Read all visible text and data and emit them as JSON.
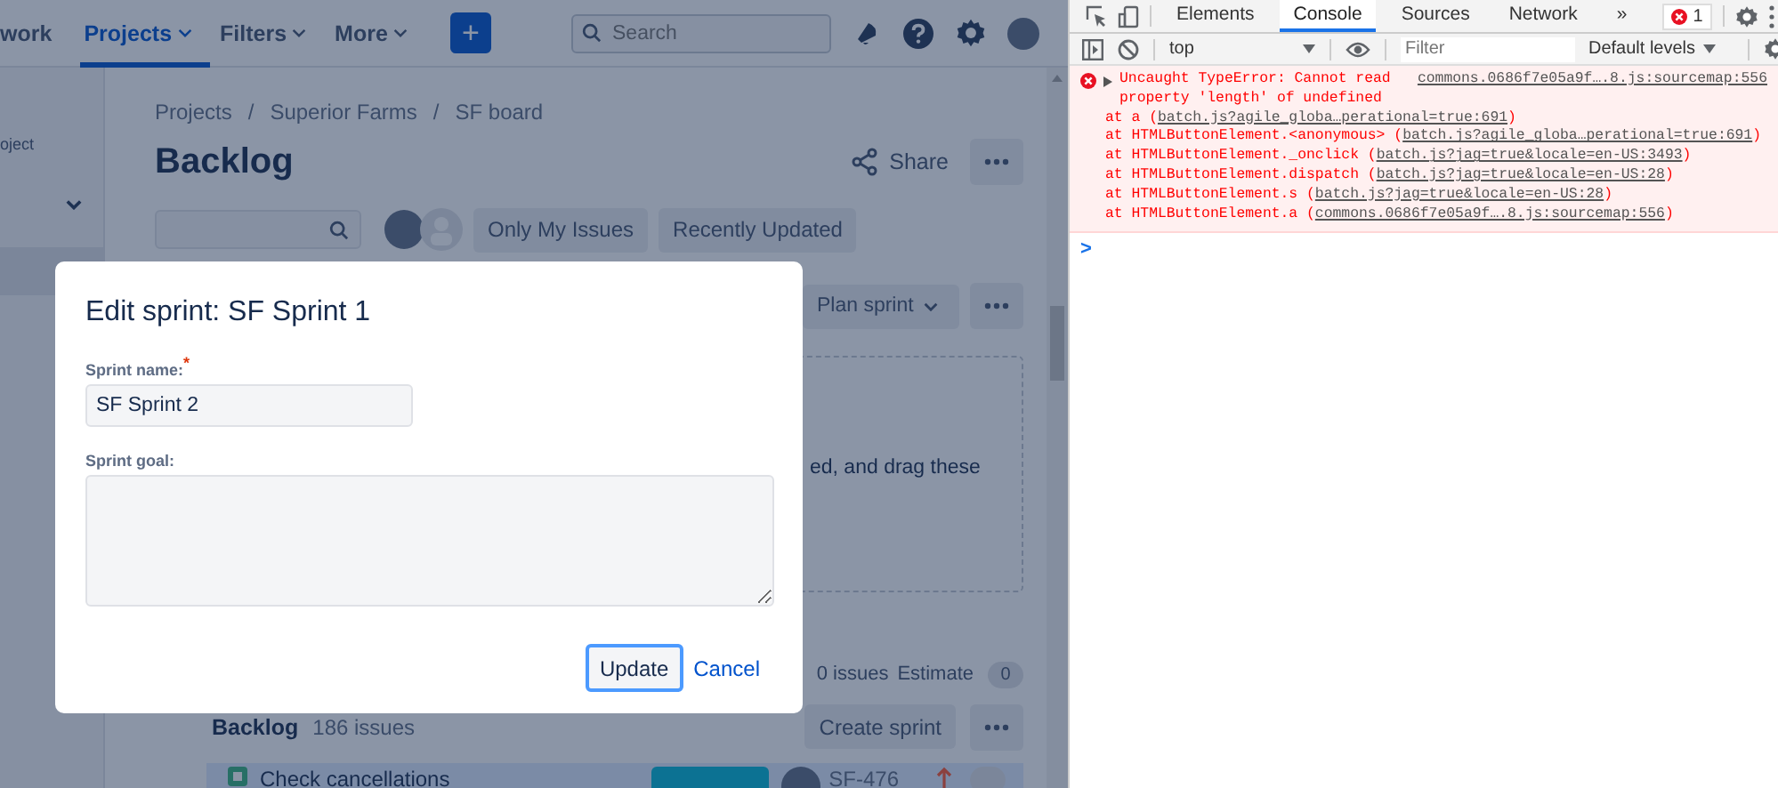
{
  "nav": {
    "items": [
      {
        "label": "work",
        "selected": false,
        "has_menu": false
      },
      {
        "label": "Projects",
        "selected": true,
        "has_menu": true
      },
      {
        "label": "Filters",
        "selected": false,
        "has_menu": true
      },
      {
        "label": "More",
        "selected": false,
        "has_menu": true
      }
    ],
    "create_label": "+",
    "search_placeholder": "Search"
  },
  "sidebar": {
    "items": [
      {
        "label": "oject"
      }
    ]
  },
  "breadcrumbs": [
    "Projects",
    "Superior Farms",
    "SF board"
  ],
  "breadcrumb_separator": "/",
  "title": "Backlog",
  "share_label": "Share",
  "quick_filters": [
    "Only My Issues",
    "Recently Updated"
  ],
  "sprint": {
    "plan_label": "Plan sprint",
    "empty_text": "ed, and drag these",
    "issue_count": "0 issues",
    "estimate_label": "Estimate",
    "estimate": "0"
  },
  "backlog": {
    "title": "Backlog",
    "count": "186 issues",
    "create_label": "Create sprint",
    "issues": [
      {
        "summary": "Check cancellations",
        "key": "SF-476"
      }
    ]
  },
  "modal": {
    "title": "Edit sprint: SF Sprint 1",
    "fields": [
      {
        "kind": "text",
        "label": "Sprint name:",
        "required_mark": "*",
        "value": "SF Sprint 2"
      },
      {
        "kind": "textarea",
        "label": "Sprint goal:"
      }
    ],
    "primary_label": "Update",
    "cancel_label": "Cancel"
  },
  "devtools": {
    "tabs": [
      {
        "label": "Elements",
        "selected": false
      },
      {
        "label": "Console",
        "selected": true
      },
      {
        "label": "Sources",
        "selected": false
      },
      {
        "label": "Network",
        "selected": false
      }
    ],
    "overflow": "»",
    "error_count": "1",
    "context": "top",
    "filter_placeholder": "Filter",
    "levels": "Default levels",
    "messages": [
      {
        "kind": "error",
        "text": "Uncaught TypeError: Cannot read property 'length' of undefined",
        "source": "commons.0686f7e05a9f….8.js:sourcemap:556",
        "stack": [
          {
            "prefix": "at a (",
            "link": "batch.js?agile_globa…perational=true:691",
            "suffix": ")"
          },
          {
            "prefix": "at HTMLButtonElement.<anonymous> (",
            "link": "batch.js?agile_globa…perational=true:691",
            "suffix": ")"
          },
          {
            "prefix": "at HTMLButtonElement._onclick (",
            "link": "batch.js?jag=true&locale=en-US:3493",
            "suffix": ")"
          },
          {
            "prefix": "at HTMLButtonElement.dispatch (",
            "link": "batch.js?jag=true&locale=en-US:28",
            "suffix": ")"
          },
          {
            "prefix": "at HTMLButtonElement.s (",
            "link": "batch.js?jag=true&locale=en-US:28",
            "suffix": ")"
          },
          {
            "prefix": "at HTMLButtonElement.a (",
            "link": "commons.0686f7e05a9f….8.js:sourcemap:556",
            "suffix": ")"
          }
        ]
      }
    ],
    "prompt": ">"
  }
}
